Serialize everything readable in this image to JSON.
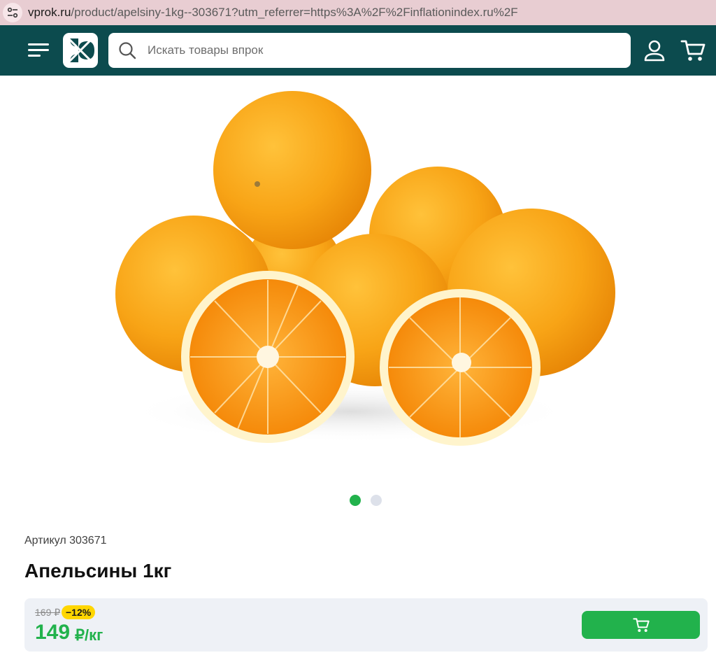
{
  "browser": {
    "url_domain": "vprok.ru",
    "url_path": "/product/apelsiny-1kg--303671?utm_referrer=https%3A%2F%2Finflationindex.ru%2F"
  },
  "header": {
    "menu_icon": "menu-icon",
    "logo_icon": "logo-icon",
    "search_placeholder": "Искать товары впрок",
    "profile_icon": "user-icon",
    "cart_icon": "cart-icon"
  },
  "gallery": {
    "slides": 2,
    "active_slide": 1
  },
  "product": {
    "sku_label": "Артикул 303671",
    "title": "Апельсины 1кг",
    "old_price": "169 ₽",
    "discount": "−12%",
    "price": "149",
    "unit": "₽/кг"
  },
  "colors": {
    "header_bg": "#0c4b4e",
    "accent_green": "#22b24c",
    "badge_yellow": "#ffd600",
    "price_bg": "#eef1f6"
  }
}
